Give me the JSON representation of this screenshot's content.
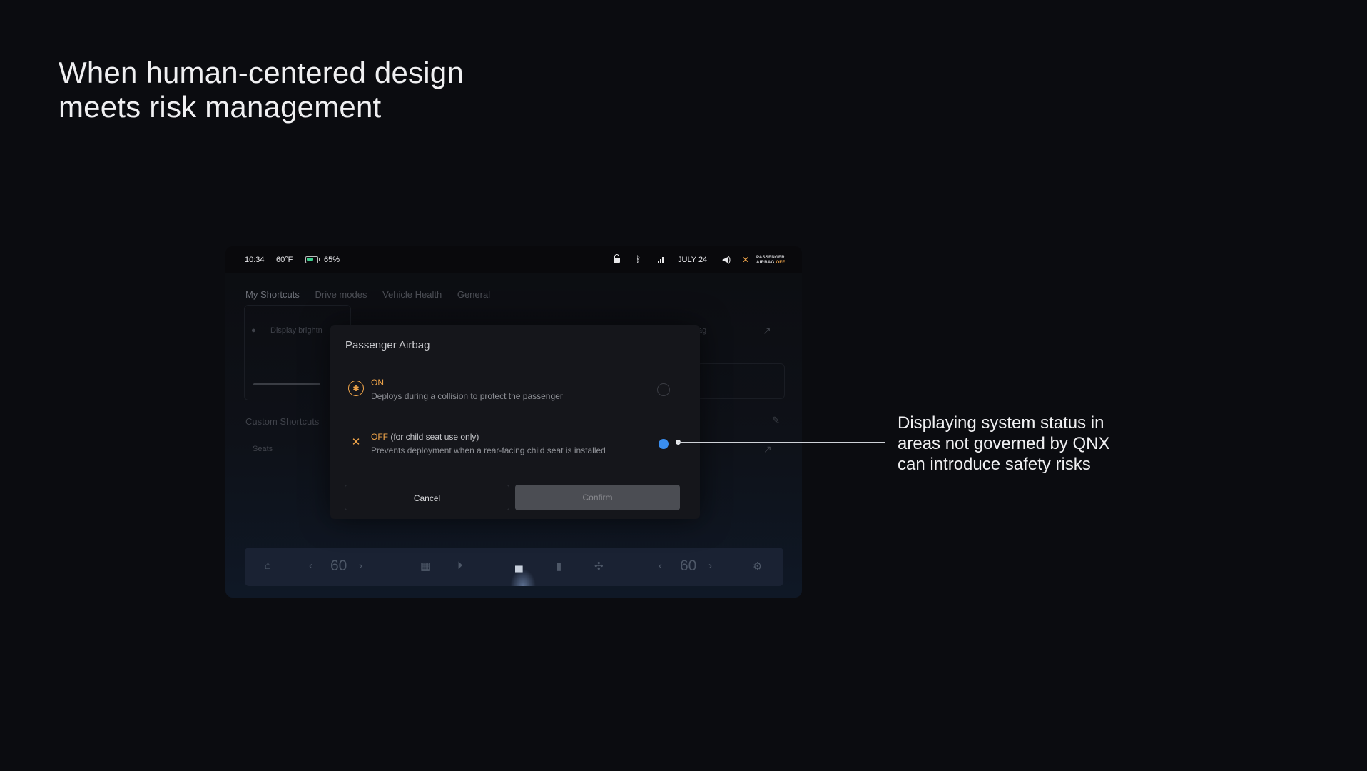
{
  "slide": {
    "heading_line1": "When human-centered design",
    "heading_line2": "meets risk management",
    "callout_line1": "Displaying system status in",
    "callout_line2": "areas not governed by QNX",
    "callout_line3": "can introduce safety risks"
  },
  "status_bar": {
    "time": "10:34",
    "temperature": "60°F",
    "battery": "65%",
    "date": "JULY 24",
    "airbag_label_line1": "PASSENGER",
    "airbag_label_line2": "AIRBAG",
    "airbag_state": "OFF"
  },
  "tabs": [
    "My Shortcuts",
    "Drive modes",
    "Vehicle Health",
    "General"
  ],
  "background": {
    "display_brightness": "Display brightn",
    "partial_airbag": "ag",
    "custom_shortcuts": "Custom Shortcuts",
    "seats": "Seats"
  },
  "dock": {
    "left_temp": "60",
    "right_temp": "60"
  },
  "dialog": {
    "title": "Passenger Airbag",
    "on_label": "ON",
    "on_desc": "Deploys during a collision to protect the passenger",
    "off_label": "OFF",
    "off_suffix": " (for child seat use only)",
    "off_desc": "Prevents deployment when a rear-facing child seat is installed",
    "selected": "OFF",
    "cancel": "Cancel",
    "confirm": "Confirm"
  },
  "colors": {
    "accent_orange": "#f2a64a",
    "radio_selected": "#3a8ef0",
    "battery_green": "#3ecf8e"
  }
}
